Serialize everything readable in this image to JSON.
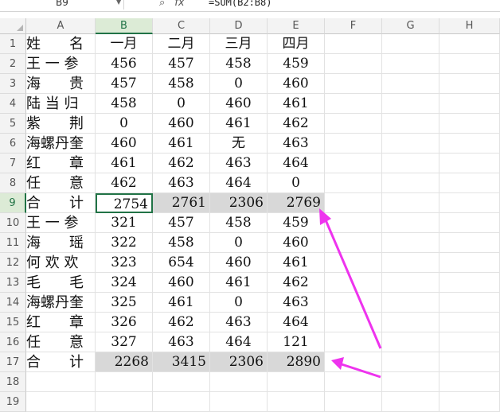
{
  "formula_bar": {
    "cell_ref": "B9",
    "formula": "=SUM(B2:B8)",
    "fx_label": "fx",
    "zoom_icon": "magnifier-icon"
  },
  "columns": [
    "A",
    "B",
    "C",
    "D",
    "E",
    "F",
    "G",
    "H"
  ],
  "rows": [
    "1",
    "2",
    "3",
    "4",
    "5",
    "6",
    "7",
    "8",
    "9",
    "10",
    "11",
    "12",
    "13",
    "14",
    "15",
    "16",
    "17",
    "18",
    "19"
  ],
  "selected_column": "B",
  "selected_row": "9",
  "header_row": [
    "姓　　名",
    "一月",
    "二月",
    "三月",
    "四月"
  ],
  "data_rows": [
    [
      "王 一 参",
      "456",
      "457",
      "458",
      "459"
    ],
    [
      "海　　贵",
      "457",
      "458",
      "0",
      "460"
    ],
    [
      "陆 当 归",
      "458",
      "0",
      "460",
      "461"
    ],
    [
      "紫　　荆",
      "0",
      "460",
      "461",
      "462"
    ],
    [
      "海螺丹奎",
      "460",
      "461",
      "无",
      "463"
    ],
    [
      "红　　章",
      "461",
      "462",
      "463",
      "464"
    ],
    [
      "任　　意",
      "462",
      "463",
      "464",
      "0"
    ],
    [
      "合　　计",
      "2754",
      "2761",
      "2306",
      "2769"
    ],
    [
      "王 一 参",
      "321",
      "457",
      "458",
      "459"
    ],
    [
      "海　　瑶",
      "322",
      "458",
      "0",
      "460"
    ],
    [
      "何 欢 欢",
      "323",
      "654",
      "460",
      "461"
    ],
    [
      "毛　　毛",
      "324",
      "460",
      "461",
      "462"
    ],
    [
      "海螺丹奎",
      "325",
      "461",
      "0",
      "463"
    ],
    [
      "红　　章",
      "326",
      "462",
      "463",
      "464"
    ],
    [
      "任　　意",
      "327",
      "463",
      "464",
      "121"
    ],
    [
      "合　　计",
      "2268",
      "3415",
      "2306",
      "2890"
    ]
  ],
  "colors": {
    "accent": "#217346",
    "annotation_arrow": "#ee33ee",
    "total_fill": "#d8d8d8"
  }
}
